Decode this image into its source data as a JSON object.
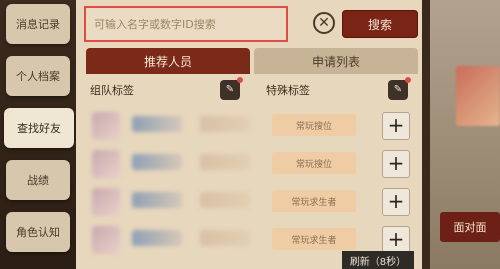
{
  "sidebar": {
    "items": [
      {
        "label": "消息记录"
      },
      {
        "label": "个人档案"
      },
      {
        "label": "查找好友"
      },
      {
        "label": "战绩"
      },
      {
        "label": "角色认知"
      }
    ]
  },
  "search": {
    "placeholder": "可输入名字或数字ID搜索",
    "clear_icon": "close-icon",
    "button_label": "搜索"
  },
  "tabs": [
    {
      "label": "推荐人员",
      "active": true
    },
    {
      "label": "申请列表",
      "active": false
    }
  ],
  "filters": {
    "team_tag": "组队标签",
    "special_tag": "特殊标签"
  },
  "list": {
    "rows": [
      {
        "tag": "常玩搜位"
      },
      {
        "tag": "常玩搜位"
      },
      {
        "tag": "常玩求生者"
      },
      {
        "tag": "常玩求生者"
      }
    ]
  },
  "refresh_label": "刷新（8秒）",
  "right_panel": {
    "face_button": "面对面"
  }
}
